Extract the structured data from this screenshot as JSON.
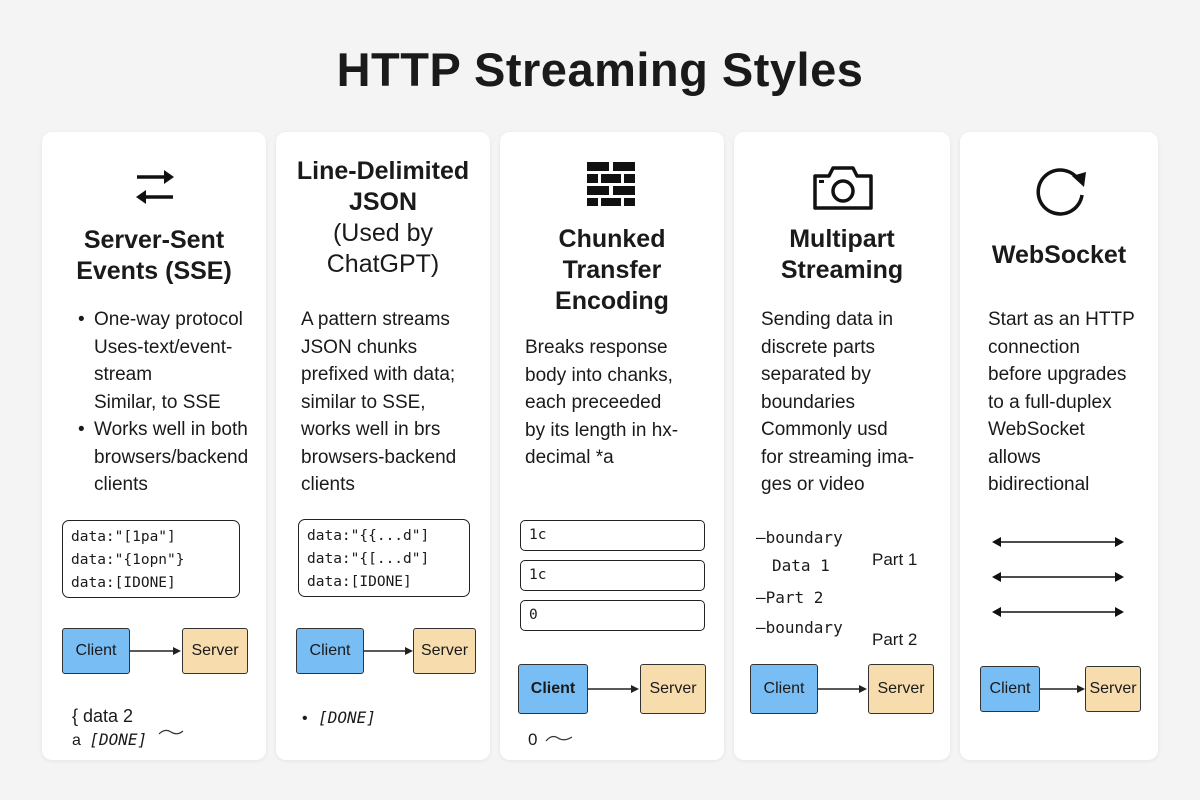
{
  "title": "HTTP Streaming Styles",
  "colors": {
    "client": "#79bdf5",
    "server": "#f7dcae",
    "text": "#1a1a1a"
  },
  "sse": {
    "icon": "swap-arrows-icon",
    "heading_1": "Server-Sent",
    "heading_2": "Events (SSE)",
    "bullets": [
      "One-way protocol",
      "Uses-text/event-",
      "stream",
      "Similar, to SSE",
      "Works well in both",
      "browsers/backend",
      "clients"
    ],
    "code": [
      "data:\"[1pa\"]",
      "data:\"{1opn\"}",
      "data:[IDONE]"
    ],
    "client_label": "Client",
    "server_label": "Server",
    "footer_1": "{ data 2",
    "footer_2_prefix": "a",
    "footer_2_code": "[DONE]"
  },
  "ndjson": {
    "heading_1": "Line-Delimited",
    "heading_2": "JSON",
    "sub_1": "(Used by",
    "sub_2": "ChatGPT)",
    "lines": [
      "A pattern streams",
      "JSON chunks",
      "prefixed with data;",
      "similar to SSE,",
      "works well in brs",
      "browsers-backend",
      "clients"
    ],
    "code": [
      "data:\"{{...d\"]",
      "data:\"{[...d\"]",
      "data:[IDONE]"
    ],
    "client_label": "Client",
    "server_label": "Server",
    "footer": "[DONE]"
  },
  "chunked": {
    "icon": "brick-wall-icon",
    "heading_1": "Chunked",
    "heading_2": "Transfer",
    "heading_3": "Encoding",
    "lines": [
      "Breaks response",
      "body into chanks,",
      "each preceeded",
      "by its length in hx-",
      "decimal *a"
    ],
    "chunks": [
      "1c",
      "1c",
      "0"
    ],
    "client_label": "Client",
    "server_label": "Server",
    "footer": "0"
  },
  "multipart": {
    "icon": "camera-icon",
    "heading_1": "Multipart",
    "heading_2": "Streaming",
    "lines": [
      "Sending data in",
      "discrete parts",
      "separated by",
      "boundaries",
      "Commonly usd",
      "for streaming ima-",
      "ges or video"
    ],
    "boundary_1": "—boundary",
    "data_1": "Data 1",
    "part_1": "Part 1",
    "part_2_code": "—Part 2",
    "boundary_2": "—boundary",
    "part_2": "Part 2",
    "client_label": "Client",
    "server_label": "Server"
  },
  "websocket": {
    "icon": "refresh-icon",
    "heading": "WebSocket",
    "lines": [
      "Start as an HTTP",
      "connection",
      "before upgrades",
      "to a full-duplex",
      "WebSocket",
      "allows",
      "bidirectional"
    ],
    "client_label": "Client",
    "server_label": "Server"
  }
}
